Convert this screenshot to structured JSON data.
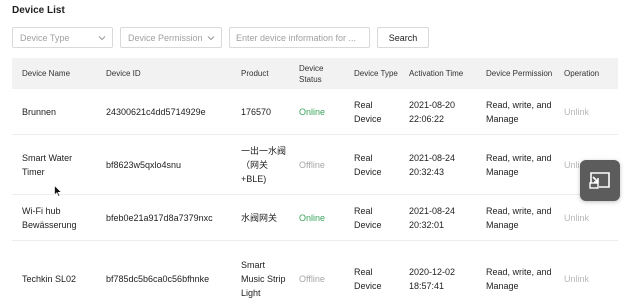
{
  "page": {
    "title": "Device List"
  },
  "filters": {
    "device_type_placeholder": "Device Type",
    "device_permission_placeholder": "Device Permission",
    "search_placeholder": "Enter device information for ...",
    "search_button": "Search"
  },
  "table": {
    "headers": [
      "Device Name",
      "Device ID",
      "Product",
      "Device Status",
      "Device Type",
      "Activation Time",
      "Device Permission",
      "Operation"
    ],
    "rows": [
      {
        "name": "Brunnen",
        "id": "24300621c4dd5714929e",
        "product": "176570",
        "status": "Online",
        "type": "Real Device",
        "activation": "2021-08-20 22:06:22",
        "permission": "Read, write, and Manage",
        "operation": "Unlink"
      },
      {
        "name": "Smart Water Timer",
        "id": "bf8623w5qxlo4snu",
        "product": "一出一水阀（网关+BLE)",
        "status": "Offline",
        "type": "Real Device",
        "activation": "2021-08-24 20:32:43",
        "permission": "Read, write, and Manage",
        "operation": "Unlink"
      },
      {
        "name": "Wi-Fi hub Bewässerung",
        "id": "bfeb0e21a917d8a7379nxc",
        "product": "水阀网关",
        "status": "Online",
        "type": "Real Device",
        "activation": "2021-08-24 20:32:01",
        "permission": "Read, write, and Manage",
        "operation": "Unlink"
      },
      {
        "name": "Techkin SL02",
        "id": "bf785dc5b6ca0c56bfhnke",
        "product": "Smart Music Strip Light",
        "status": "Offline",
        "type": "Real Device",
        "activation": "2020-12-02 18:57:41",
        "permission": "Read, write, and Manage",
        "operation": "Unlink"
      }
    ]
  },
  "icons": {
    "filter_chevron": "chevron-down-icon",
    "floating": "picture-in-picture-icon",
    "cursor": "mouse-cursor-icon"
  },
  "colors": {
    "online": "#3aa35b",
    "offline": "#a6a6a6",
    "header_bg": "#f2f2f2",
    "floating_bg": "#5c5c5c"
  }
}
